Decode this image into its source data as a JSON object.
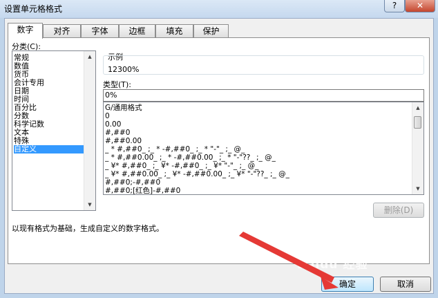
{
  "window": {
    "title": "设置单元格格式",
    "help": "?",
    "close": "✕"
  },
  "tabs": [
    {
      "label": "数字"
    },
    {
      "label": "对齐"
    },
    {
      "label": "字体"
    },
    {
      "label": "边框"
    },
    {
      "label": "填充"
    },
    {
      "label": "保护"
    }
  ],
  "category": {
    "label": "分类(C):",
    "items": [
      "常规",
      "数值",
      "货币",
      "会计专用",
      "日期",
      "时间",
      "百分比",
      "分数",
      "科学记数",
      "文本",
      "特殊",
      "自定义"
    ],
    "selected": "自定义"
  },
  "sample": {
    "label": "示例",
    "value": "12300%"
  },
  "type": {
    "label": "类型(T):",
    "value": "0%",
    "formats": [
      "G/通用格式",
      "0",
      "0.00",
      "#,##0",
      "#,##0.00",
      "_ * #,##0_ ;_ * -#,##0_ ;_ * \"-\"_ ;_ @_",
      "_ * #,##0.00_ ;_ * -#,##0.00_ ;_ * \"-\"??_ ;_ @_",
      "_ ¥* #,##0_ ;_ ¥* -#,##0_ ;_ ¥* \"-\"_ ;_ @_",
      "_ ¥* #,##0.00_ ;_ ¥* -#,##0.00_ ;_ ¥* \"-\"??_ ;_ @_",
      "#,##0;-#,##0",
      "#,##0;[红色]-#,##0"
    ]
  },
  "delete_label": "删除(D)",
  "description": "以现有格式为基础，生成自定义的数字格式。",
  "ok_label": "确定",
  "cancel_label": "取消",
  "watermark": "Baidu 经验",
  "colors": {
    "selection": "#3399ff",
    "annotation_arrow": "#e53935"
  }
}
